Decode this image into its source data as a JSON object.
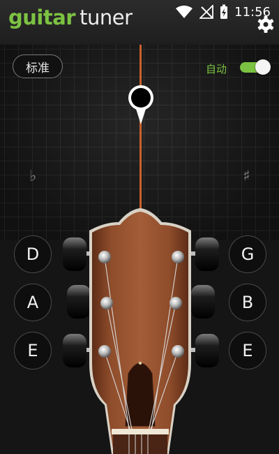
{
  "app": {
    "title_part1": "guitar",
    "title_part2": "tuner"
  },
  "status_bar": {
    "time": "11:56",
    "icons": [
      "wifi-icon",
      "no-signal-icon",
      "battery-charging-icon"
    ]
  },
  "header": {
    "settings_icon": "gear-icon"
  },
  "tuning": {
    "preset_label": "标准"
  },
  "auto_mode": {
    "label": "自动",
    "enabled": true
  },
  "meter": {
    "flat_symbol": "♭",
    "sharp_symbol": "♯"
  },
  "strings": {
    "left": [
      {
        "note": "D"
      },
      {
        "note": "A"
      },
      {
        "note": "E"
      }
    ],
    "right": [
      {
        "note": "G"
      },
      {
        "note": "B"
      },
      {
        "note": "E"
      }
    ]
  },
  "colors": {
    "accent": "#7cc242",
    "needle": "#c9612c",
    "wood": "#8a4a2a"
  }
}
